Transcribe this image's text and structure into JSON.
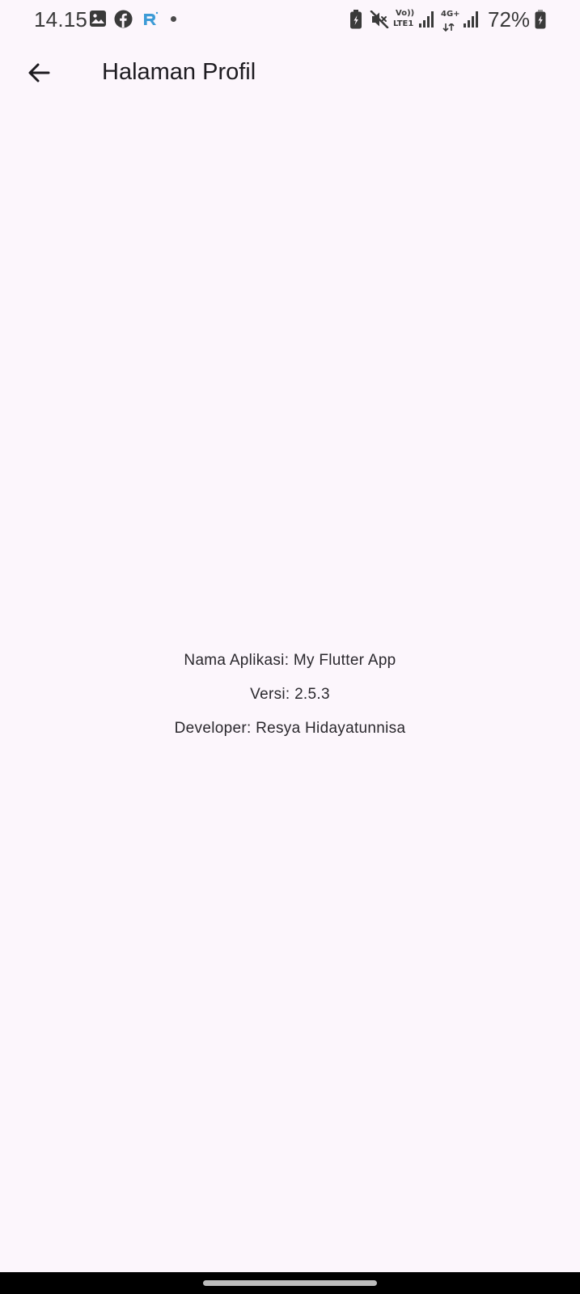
{
  "status_bar": {
    "time": "14.15",
    "notification_icons": [
      "gallery-icon",
      "facebook-icon",
      "app-r-icon",
      "dot-icon"
    ],
    "volte_label": "Vo))",
    "lte_label": "LTE1",
    "network_label": "4G+",
    "battery_percent": "72%",
    "colors": {
      "text": "#3a3a3a",
      "accent_r": "#3d9bd6"
    }
  },
  "app_bar": {
    "back_icon": "arrow-back-icon",
    "title": "Halaman Profil"
  },
  "profile": {
    "app_name_line": "Nama Aplikasi: My Flutter App",
    "version_line": "Versi: 2.5.3",
    "developer_line": "Developer: Resya Hidayatunnisa"
  },
  "theme": {
    "background": "#fcf6fc",
    "text": "#1d1b20",
    "nav_bar": "#000000"
  }
}
